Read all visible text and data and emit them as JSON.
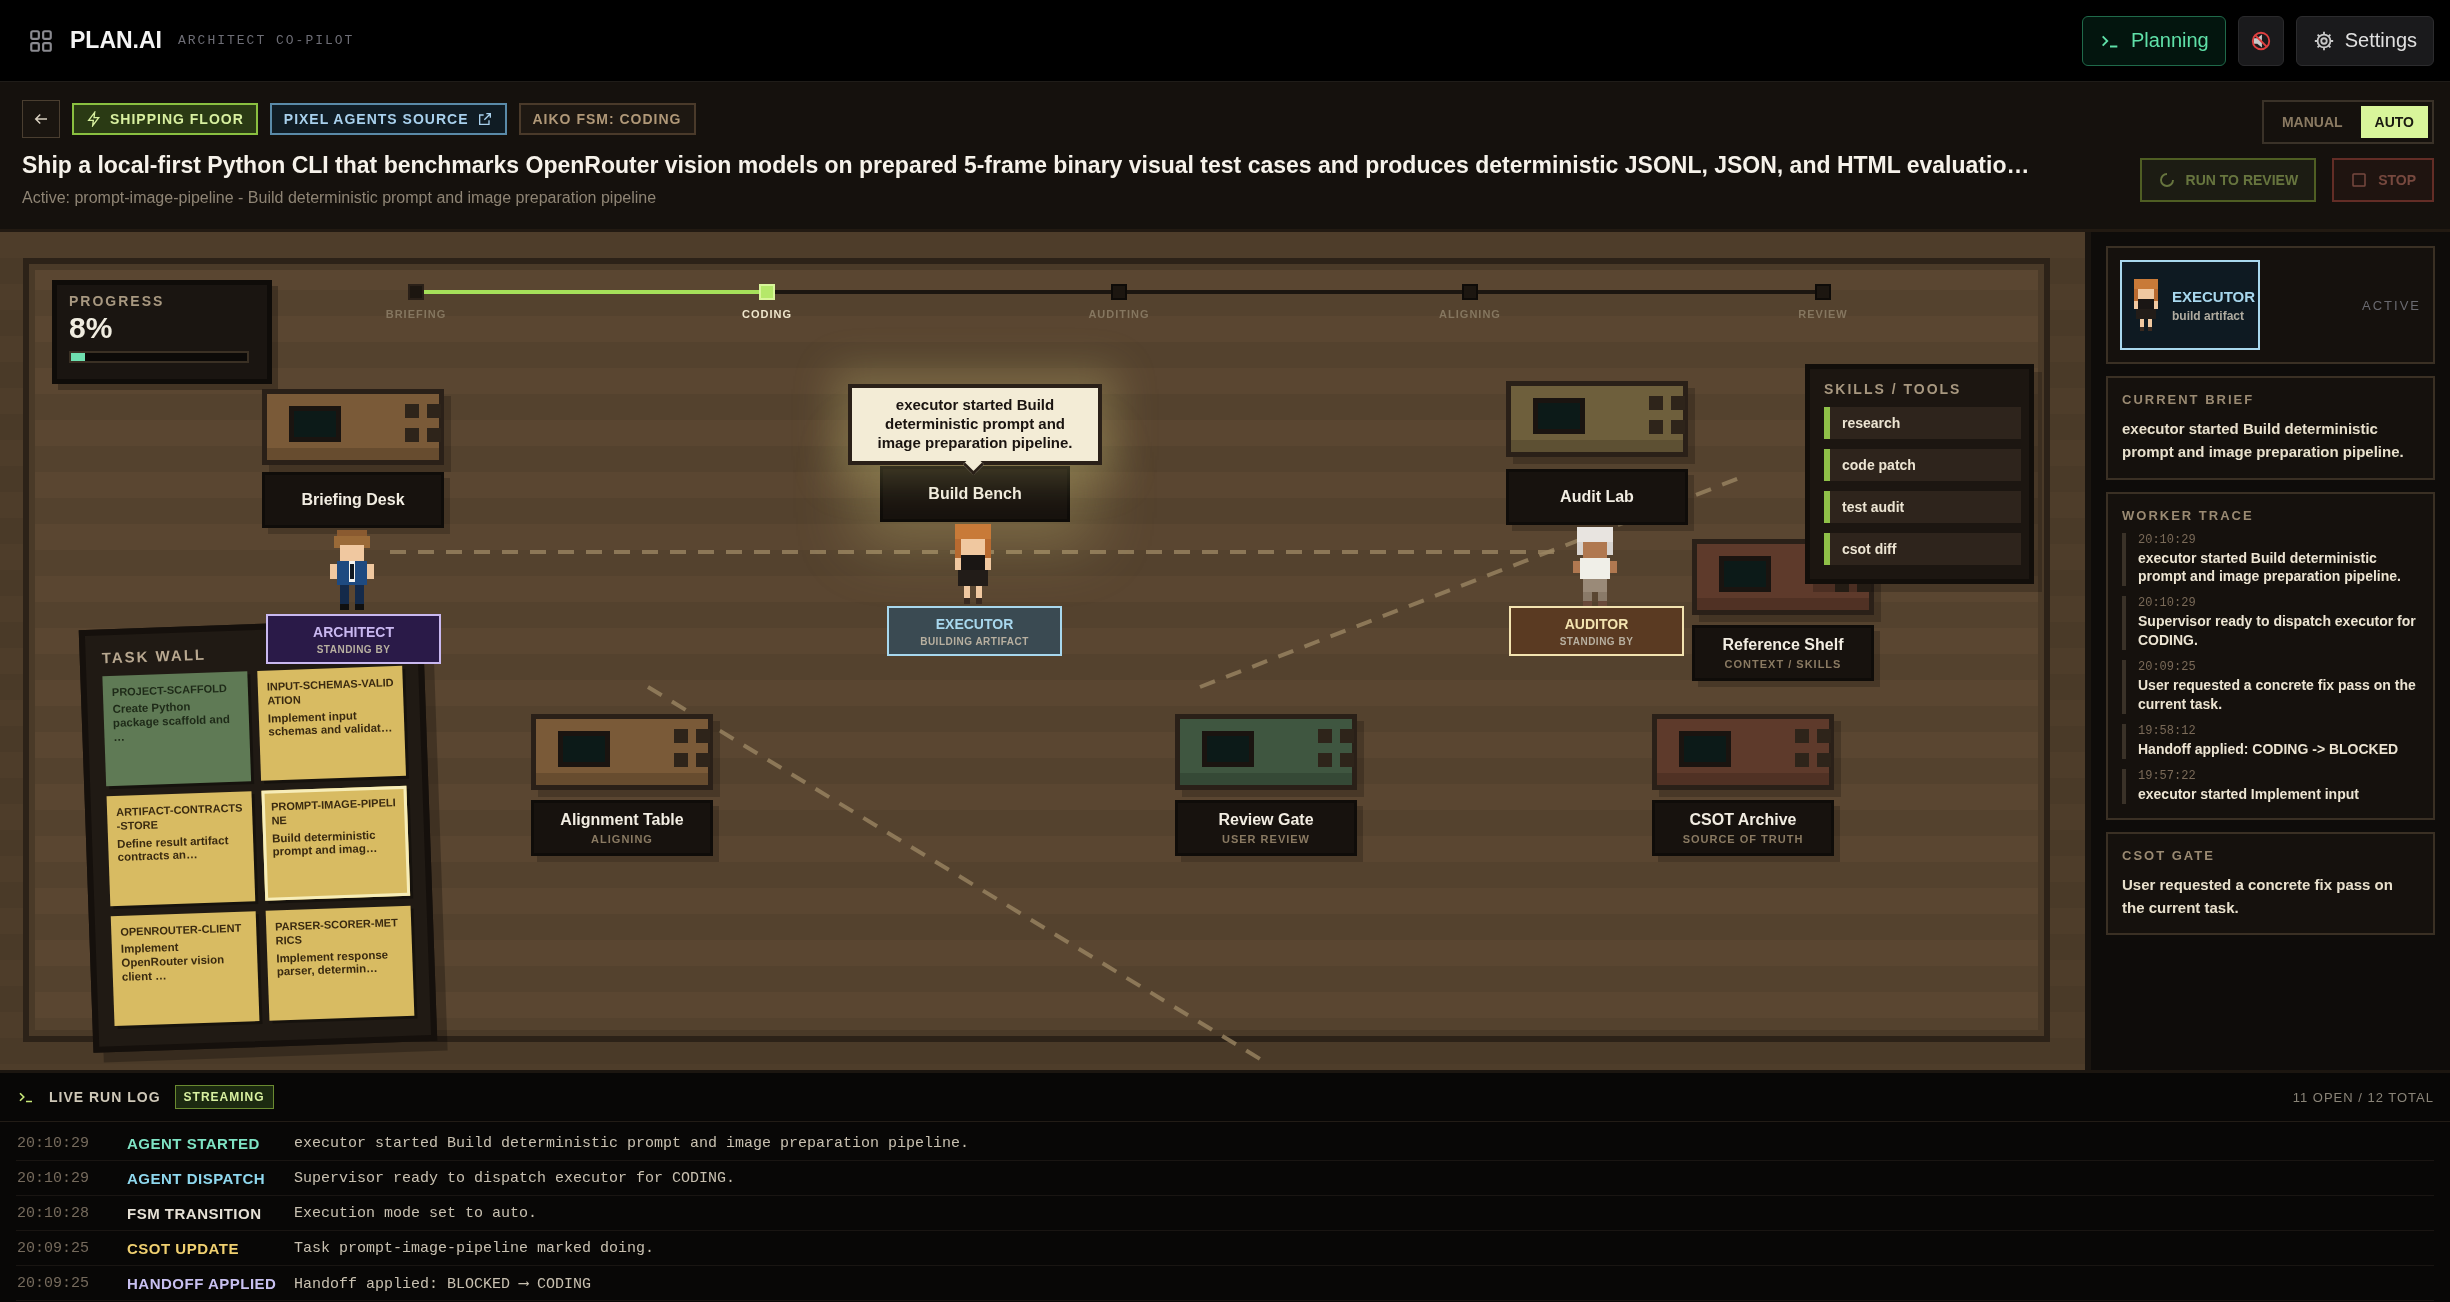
{
  "topbar": {
    "brand": "PLAN.AI",
    "subtitle": "ARCHITECT CO-PILOT",
    "buttons": [
      {
        "kind": "terminal",
        "label": "Planning"
      },
      {
        "kind": "mute"
      },
      {
        "kind": "settings",
        "label": "Settings"
      }
    ]
  },
  "header": {
    "tags": [
      {
        "kind": "floor",
        "label": "SHIPPING FLOOR"
      },
      {
        "kind": "link",
        "label": "PIXEL AGENTS SOURCE"
      },
      {
        "kind": "state",
        "label": "AIKO FSM: CODING"
      }
    ],
    "title": "Ship a local-first Python CLI that benchmarks OpenRouter vision models on prepared 5-frame binary visual test cases and produces deterministic JSONL, JSON, and HTML evaluatio…",
    "active_line": "Active: prompt-image-pipeline - Build deterministic prompt and image preparation pipeline",
    "modes": [
      {
        "label": "MANUAL",
        "selected": false
      },
      {
        "label": "AUTO",
        "selected": true
      }
    ],
    "actions": [
      {
        "kind": "run",
        "label": "RUN TO REVIEW",
        "disabled": true
      },
      {
        "kind": "stop",
        "label": "STOP",
        "disabled": true
      }
    ]
  },
  "floor": {
    "progress": {
      "label": "PROGRESS",
      "value": "8%",
      "level": 0.08
    },
    "stages": [
      {
        "label": "BRIEFING",
        "done": true,
        "selected": false
      },
      {
        "label": "CODING",
        "done": false,
        "selected": true
      },
      {
        "label": "AUDITING",
        "done": false,
        "selected": false
      },
      {
        "label": "ALIGNING",
        "done": false,
        "selected": false
      },
      {
        "label": "REVIEW",
        "done": false,
        "selected": false
      }
    ],
    "stations": [
      {
        "name": "Briefing Desk",
        "color": "#7a5a38",
        "active": false
      },
      {
        "name": "Build Bench",
        "active": true
      },
      {
        "name": "Audit Lab",
        "color": "#6e5f3c",
        "active": false
      },
      {
        "name": "Reference Shelf",
        "subtitle": "CONTEXT / SKILLS",
        "color": "#5e3a2b",
        "active": false
      },
      {
        "name": "Alignment Table",
        "subtitle": "ALIGNING",
        "color": "#7a5a38",
        "active": false
      },
      {
        "name": "Review Gate",
        "subtitle": "USER REVIEW",
        "color": "#3f5640",
        "active": false
      },
      {
        "name": "CSOT Archive",
        "subtitle": "SOURCE OF TRUTH",
        "color": "#5e3a2b",
        "active": false
      }
    ],
    "bubble": "executor started Build deterministic prompt and image preparation pipeline.",
    "agents": [
      {
        "kind": "architect",
        "name": "ARCHITECT",
        "status": "STANDING BY",
        "color": "#c9b8f0"
      },
      {
        "kind": "executor",
        "name": "EXECUTOR",
        "status": "BUILDING ARTIFACT",
        "color": "#a8d8ee"
      },
      {
        "kind": "auditor",
        "name": "AUDITOR",
        "status": "STANDING BY",
        "color": "#f3e3b0"
      }
    ],
    "skills": {
      "title": "SKILLS / TOOLS",
      "items": [
        "research",
        "code patch",
        "test audit",
        "csot diff"
      ]
    },
    "task_wall": {
      "title": "TASK WALL",
      "cards": [
        {
          "title": "PROJECT-SCAFFOLD",
          "text": "Create Python package scaffold and …",
          "done": true,
          "selected": false
        },
        {
          "title": "INPUT-SCHEMAS-VALIDATION",
          "text": "Implement input schemas and validat…",
          "done": false,
          "selected": false
        },
        {
          "title": "ARTIFACT-CONTRACTS-STORE",
          "text": "Define result artifact contracts an…",
          "done": false,
          "selected": false
        },
        {
          "title": "PROMPT-IMAGE-PIPELINE",
          "text": "Build deterministic prompt and imag…",
          "done": false,
          "selected": true
        },
        {
          "title": "OPENROUTER-CLIENT",
          "text": "Implement OpenRouter vision client …",
          "done": false,
          "selected": false
        },
        {
          "title": "PARSER-SCORER-METRICS",
          "text": "Implement response parser, determin…",
          "done": false,
          "selected": false
        }
      ]
    }
  },
  "panel": {
    "agent": {
      "kind": "executor",
      "name": "EXECUTOR",
      "role": "build artifact",
      "status": "ACTIVE"
    },
    "brief": {
      "title": "CURRENT BRIEF",
      "text": "executor started Build deterministic prompt and image preparation pipeline."
    },
    "trace": {
      "title": "WORKER TRACE",
      "entries": [
        {
          "time": "20:10:29",
          "text": "executor started Build deterministic prompt and image preparation pipeline."
        },
        {
          "time": "20:10:29",
          "text": "Supervisor ready to dispatch executor for CODING."
        },
        {
          "time": "20:09:25",
          "text": "User requested a concrete fix pass on the current task."
        },
        {
          "time": "19:58:12",
          "text": "Handoff applied: CODING -> BLOCKED"
        },
        {
          "time": "19:57:22",
          "text": "executor started Implement input"
        }
      ]
    },
    "gate": {
      "title": "CSOT GATE",
      "text": "User requested a concrete fix pass on the current task."
    }
  },
  "log": {
    "title": "LIVE RUN LOG",
    "badge": "STREAMING",
    "summary": "11 OPEN / 12 TOTAL",
    "rows": [
      {
        "time": "20:10:29",
        "event": "AGENT STARTED",
        "color": "#7fe3c4",
        "message": "executor started Build deterministic prompt and image preparation pipeline."
      },
      {
        "time": "20:10:29",
        "event": "AGENT DISPATCH",
        "color": "#8fd8ee",
        "message": "Supervisor ready to dispatch executor for CODING."
      },
      {
        "time": "20:10:28",
        "event": "FSM TRANSITION",
        "color": "#e6e1d6",
        "message": "Execution mode set to auto."
      },
      {
        "time": "20:09:25",
        "event": "CSOT UPDATE",
        "color": "#f0d070",
        "message": "Task prompt-image-pipeline marked doing."
      },
      {
        "time": "20:09:25",
        "event": "HANDOFF APPLIED",
        "color": "#c8c0f0",
        "message": "Handoff applied: BLOCKED ⟶ CODING"
      }
    ]
  }
}
